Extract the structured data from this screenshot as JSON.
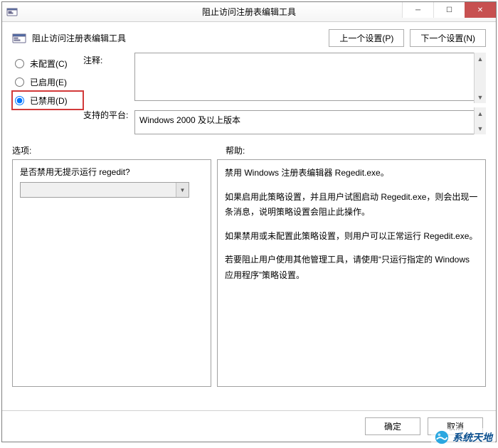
{
  "window": {
    "title": "阻止访问注册表编辑工具",
    "minimize_glyph": "─",
    "maximize_glyph": "☐",
    "close_glyph": "✕"
  },
  "header": {
    "policy_title": "阻止访问注册表编辑工具",
    "prev_btn": "上一个设置(P)",
    "next_btn": "下一个设置(N)"
  },
  "radios": {
    "not_configured": "未配置(C)",
    "enabled": "已启用(E)",
    "disabled": "已禁用(D)"
  },
  "labels": {
    "comment": "注释:",
    "supported": "支持的平台:",
    "options": "选项:",
    "help": "帮助:"
  },
  "fields": {
    "comment_value": "",
    "supported_value": "Windows 2000 及以上版本"
  },
  "options": {
    "question": "是否禁用无提示运行 regedit?",
    "selected": ""
  },
  "help": {
    "p1": "禁用 Windows 注册表编辑器 Regedit.exe。",
    "p2": "如果启用此策略设置，并且用户试图启动 Regedit.exe，则会出现一条消息，说明策略设置会阻止此操作。",
    "p3": "如果禁用或未配置此策略设置，则用户可以正常运行 Regedit.exe。",
    "p4": "若要阻止用户使用其他管理工具，请使用“只运行指定的 Windows 应用程序”策略设置。"
  },
  "footer": {
    "ok": "确定",
    "cancel": "取消"
  },
  "watermark": {
    "text": "系统天地"
  },
  "glyphs": {
    "up": "▲",
    "down": "▼",
    "caret": "▼"
  }
}
